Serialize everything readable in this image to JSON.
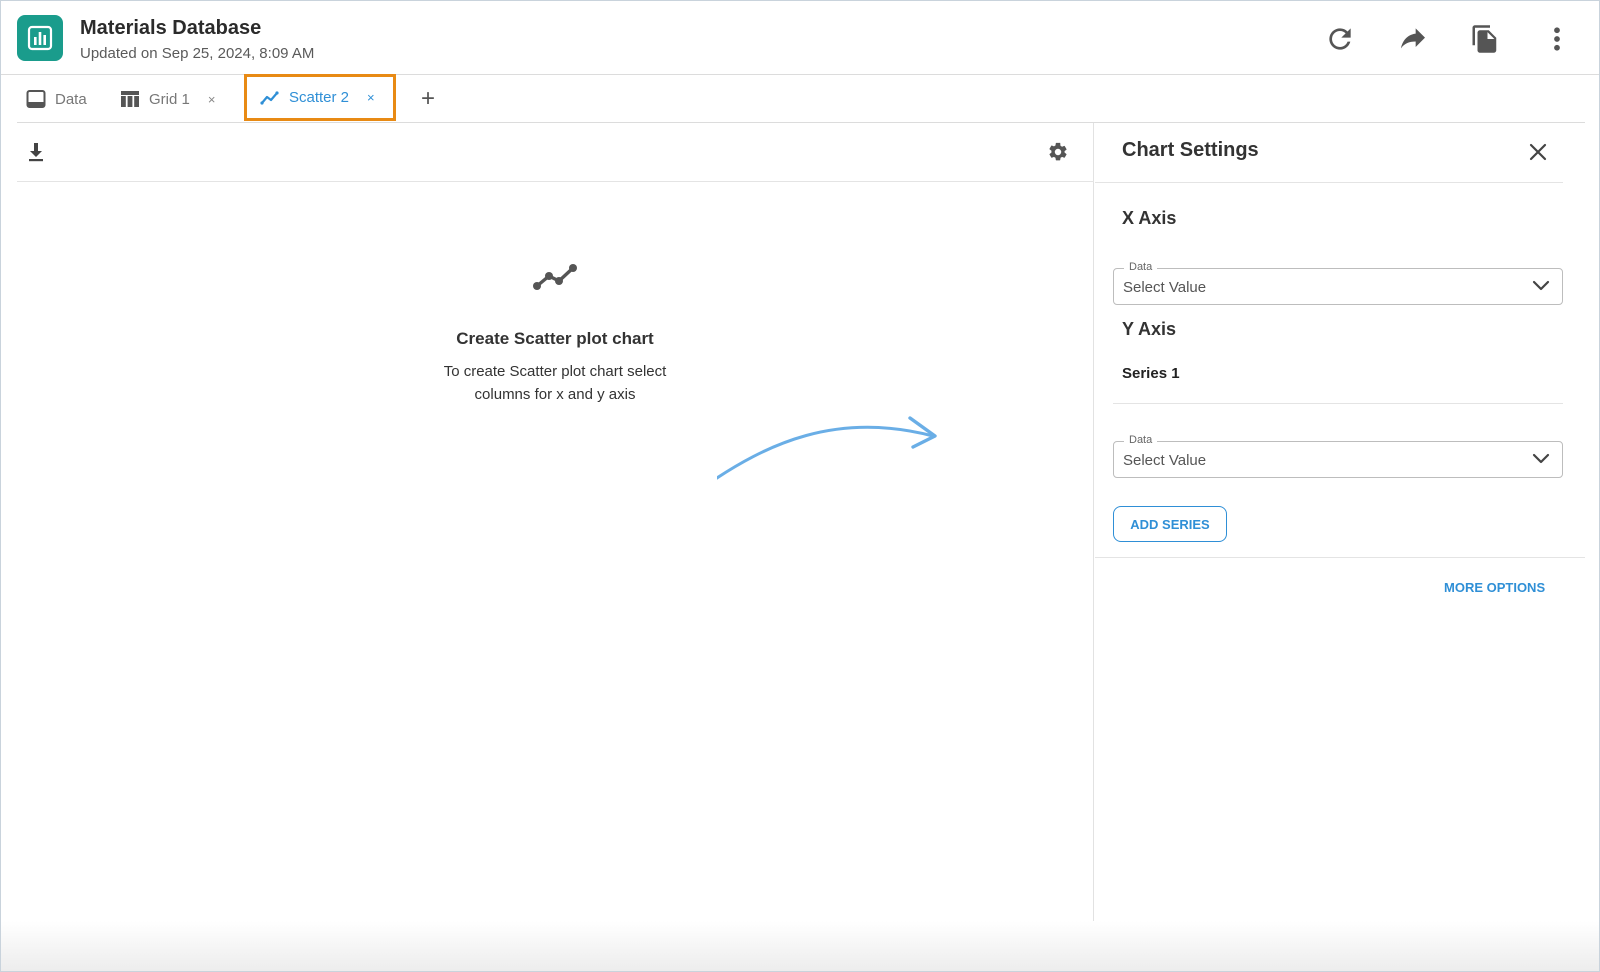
{
  "header": {
    "title": "Materials Database",
    "subtitle": "Updated on Sep 25, 2024, 8:09 AM",
    "logo_icon": "bar-chart-icon",
    "actions": [
      "refresh-icon",
      "share-icon",
      "copy-icon",
      "more-vert-icon"
    ]
  },
  "tabs": [
    {
      "label": "Data",
      "icon": "table-outline-icon",
      "closable": false
    },
    {
      "label": "Grid 1",
      "icon": "grid-icon",
      "closable": true,
      "close_label": "×"
    },
    {
      "label": "Scatter 2",
      "icon": "line-chart-icon",
      "closable": true,
      "close_label": "×",
      "active": true
    }
  ],
  "add_tab_label": "+",
  "chart": {
    "empty_title": "Create Scatter plot chart",
    "empty_desc": "To create Scatter plot chart select columns for x and y axis"
  },
  "settings": {
    "title": "Chart Settings",
    "x_axis": {
      "title": "X Axis",
      "field_label": "Data",
      "value": "Select Value"
    },
    "y_axis": {
      "title": "Y Axis",
      "series_name": "Series 1",
      "field_label": "Data",
      "value": "Select Value"
    },
    "add_series_label": "ADD SERIES",
    "more_options_label": "MORE OPTIONS"
  },
  "colors": {
    "brand": "#1a9c8c",
    "accent": "#2f8fd6",
    "highlight": "#e88a14",
    "arrow": "#6aaee6"
  }
}
